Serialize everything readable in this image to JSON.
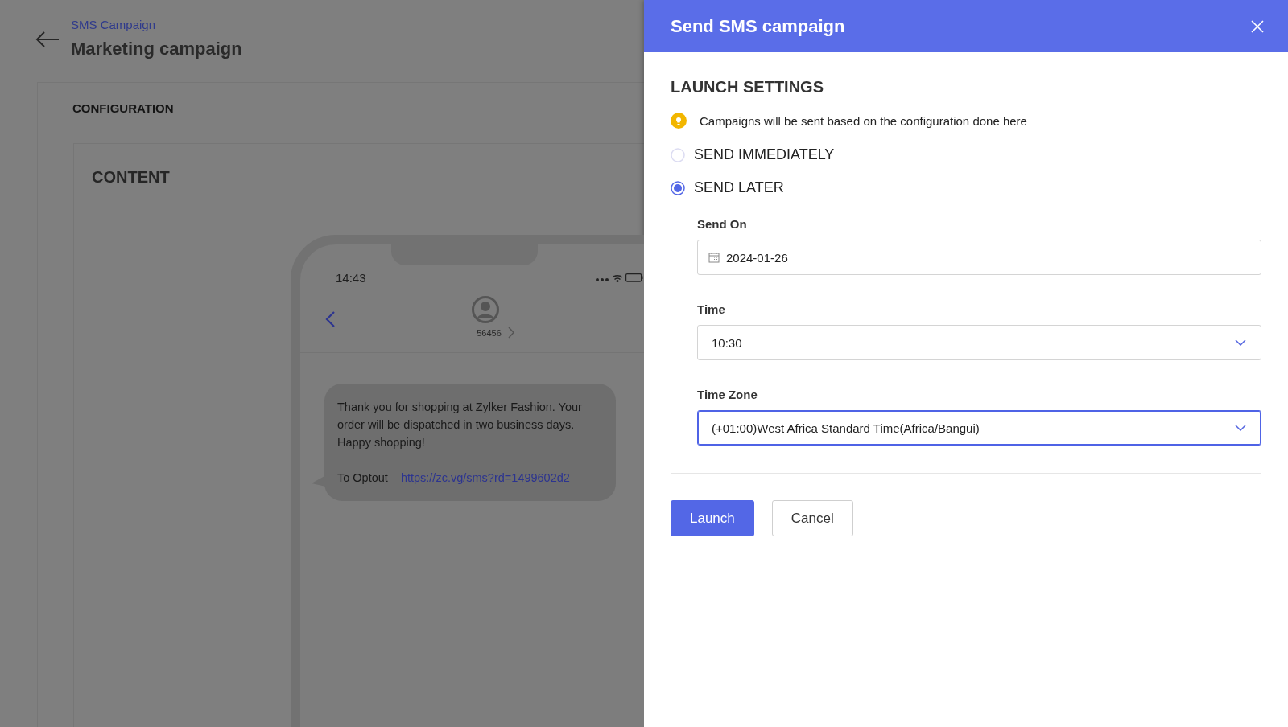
{
  "breadcrumb": "SMS Campaign",
  "page_title": "Marketing campaign",
  "section_tab": "CONFIGURATION",
  "content": {
    "heading": "CONTENT",
    "phone": {
      "time": "14:43",
      "sender": "56456",
      "message": "Thank you for shopping at Zylker Fashion. Your order will be dispatched in two business days. Happy shopping!",
      "optout_label": "To Optout",
      "optout_link": "https://zc.vg/sms?rd=1499602d2"
    }
  },
  "panel": {
    "title": "Send SMS campaign",
    "heading": "LAUNCH SETTINGS",
    "info": "Campaigns will be sent based on the configuration done here",
    "send_options": [
      {
        "label": "SEND IMMEDIATELY",
        "selected": false
      },
      {
        "label": "SEND LATER",
        "selected": true
      }
    ],
    "fields": [
      {
        "kind": "date",
        "label": "Send On",
        "value": "2024-01-26",
        "focused": false
      },
      {
        "kind": "select",
        "label": "Time",
        "value": "10:30",
        "focused": false
      },
      {
        "kind": "select",
        "label": "Time Zone",
        "value": "(+01:00)West Africa Standard Time(Africa/Bangui)",
        "focused": true
      }
    ],
    "buttons": [
      {
        "label": "Launch",
        "kind": "primary"
      },
      {
        "label": "Cancel",
        "kind": "secondary"
      }
    ]
  }
}
